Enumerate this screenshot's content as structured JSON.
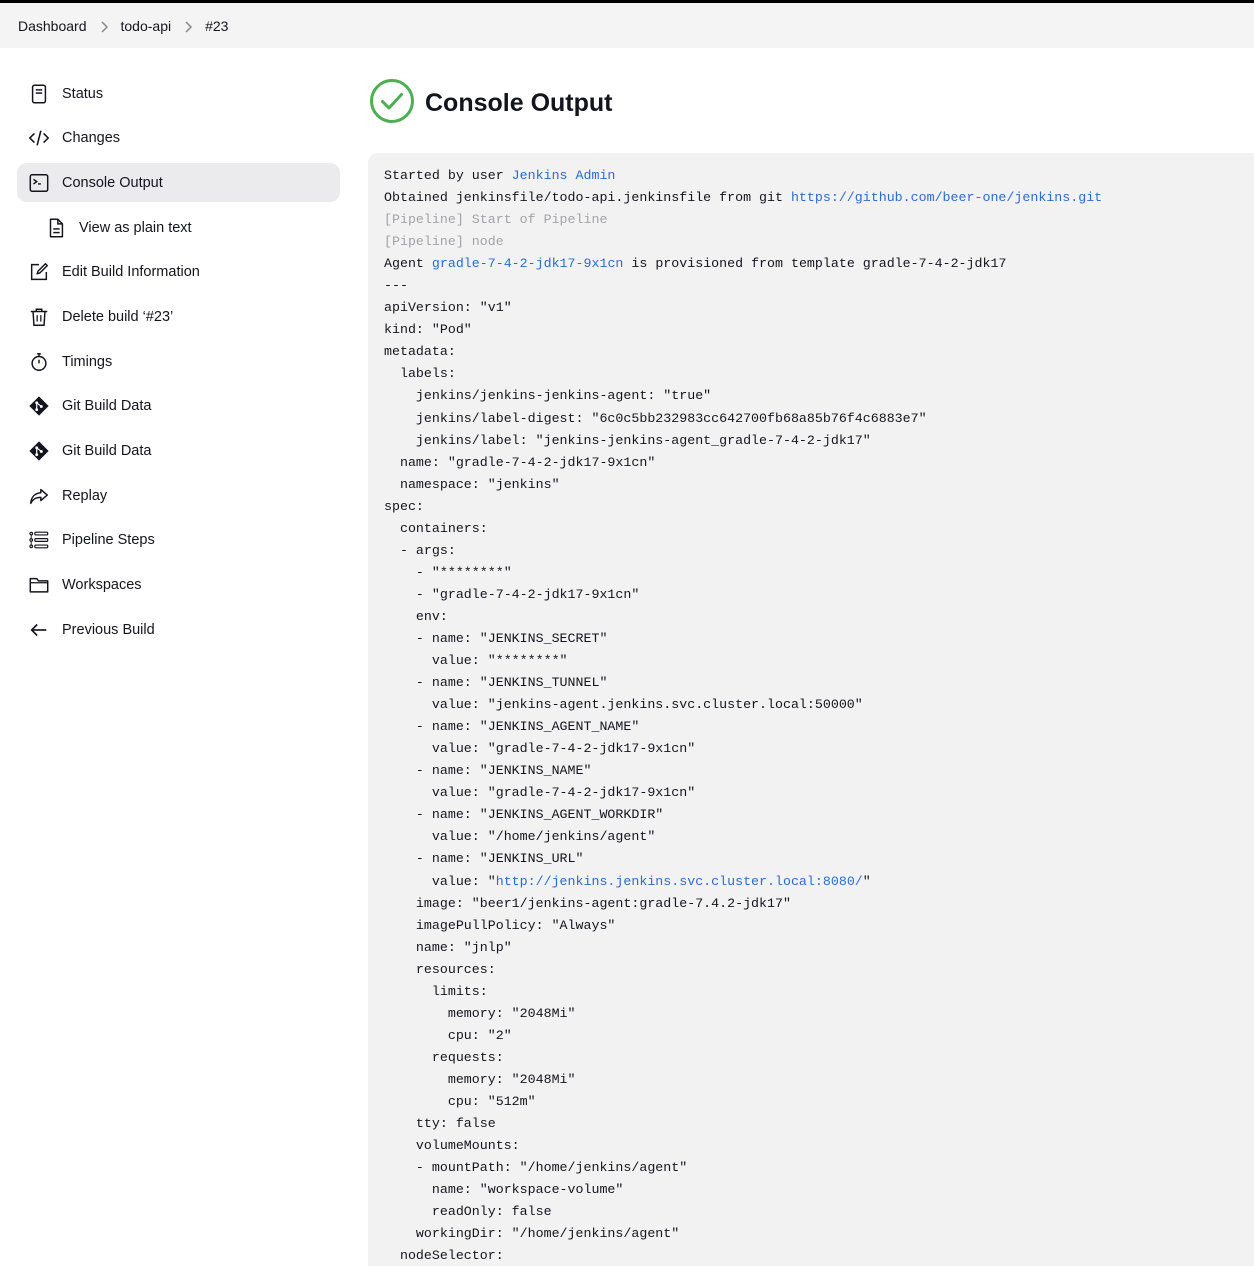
{
  "breadcrumb": [
    {
      "label": "Dashboard"
    },
    {
      "label": "todo-api"
    },
    {
      "label": "#23"
    }
  ],
  "sidebar": {
    "items": [
      {
        "label": "Status",
        "icon": "document-icon"
      },
      {
        "label": "Changes",
        "icon": "code-icon"
      },
      {
        "label": "Console Output",
        "icon": "terminal-icon",
        "active": true
      },
      {
        "label": "View as plain text",
        "icon": "file-text-icon",
        "sub": true
      },
      {
        "label": "Edit Build Information",
        "icon": "edit-icon"
      },
      {
        "label": "Delete build ‘#23’",
        "icon": "trash-icon"
      },
      {
        "label": "Timings",
        "icon": "stopwatch-icon"
      },
      {
        "label": "Git Build Data",
        "icon": "git-icon"
      },
      {
        "label": "Git Build Data",
        "icon": "git-icon"
      },
      {
        "label": "Replay",
        "icon": "replay-icon"
      },
      {
        "label": "Pipeline Steps",
        "icon": "list-icon"
      },
      {
        "label": "Workspaces",
        "icon": "folder-icon"
      },
      {
        "label": "Previous Build",
        "icon": "arrow-left-icon"
      }
    ]
  },
  "page": {
    "title": "Console Output",
    "status_color": "#4caf50"
  },
  "console": {
    "line1_prefix": "Started by user ",
    "line1_link": "Jenkins Admin",
    "line2_prefix": "Obtained jenkinsfile/todo-api.jenkinsfile from git ",
    "line2_link": "https://github.com/beer-one/jenkins.git",
    "line3": "[Pipeline] Start of Pipeline",
    "line4": "[Pipeline] node",
    "line5_prefix": "Agent ",
    "line5_link": "gradle-7-4-2-jdk17-9x1cn",
    "line5_suffix": " is provisioned from template gradle-7-4-2-jdk17",
    "yaml_a": [
      "---",
      "apiVersion: \"v1\"",
      "kind: \"Pod\"",
      "metadata:",
      "  labels:",
      "    jenkins/jenkins-jenkins-agent: \"true\"",
      "    jenkins/label-digest: \"6c0c5bb232983cc642700fb68a85b76f4c6883e7\"",
      "    jenkins/label: \"jenkins-jenkins-agent_gradle-7-4-2-jdk17\"",
      "  name: \"gradle-7-4-2-jdk17-9x1cn\"",
      "  namespace: \"jenkins\"",
      "spec:",
      "  containers:",
      "  - args:",
      "    - \"********\"",
      "    - \"gradle-7-4-2-jdk17-9x1cn\"",
      "    env:",
      "    - name: \"JENKINS_SECRET\"",
      "      value: \"********\"",
      "    - name: \"JENKINS_TUNNEL\"",
      "      value: \"jenkins-agent.jenkins.svc.cluster.local:50000\"",
      "    - name: \"JENKINS_AGENT_NAME\"",
      "      value: \"gradle-7-4-2-jdk17-9x1cn\"",
      "    - name: \"JENKINS_NAME\"",
      "      value: \"gradle-7-4-2-jdk17-9x1cn\"",
      "    - name: \"JENKINS_AGENT_WORKDIR\"",
      "      value: \"/home/jenkins/agent\"",
      "    - name: \"JENKINS_URL\""
    ],
    "url_prefix": "      value: \"",
    "url_link": "http://jenkins.jenkins.svc.cluster.local:8080/",
    "url_suffix": "\"",
    "yaml_b": [
      "    image: \"beer1/jenkins-agent:gradle-7.4.2-jdk17\"",
      "    imagePullPolicy: \"Always\"",
      "    name: \"jnlp\"",
      "    resources:",
      "      limits:",
      "        memory: \"2048Mi\"",
      "        cpu: \"2\"",
      "      requests:",
      "        memory: \"2048Mi\"",
      "        cpu: \"512m\"",
      "    tty: false",
      "    volumeMounts:",
      "    - mountPath: \"/home/jenkins/agent\"",
      "      name: \"workspace-volume\"",
      "      readOnly: false",
      "    workingDir: \"/home/jenkins/agent\"",
      "  nodeSelector:"
    ]
  }
}
